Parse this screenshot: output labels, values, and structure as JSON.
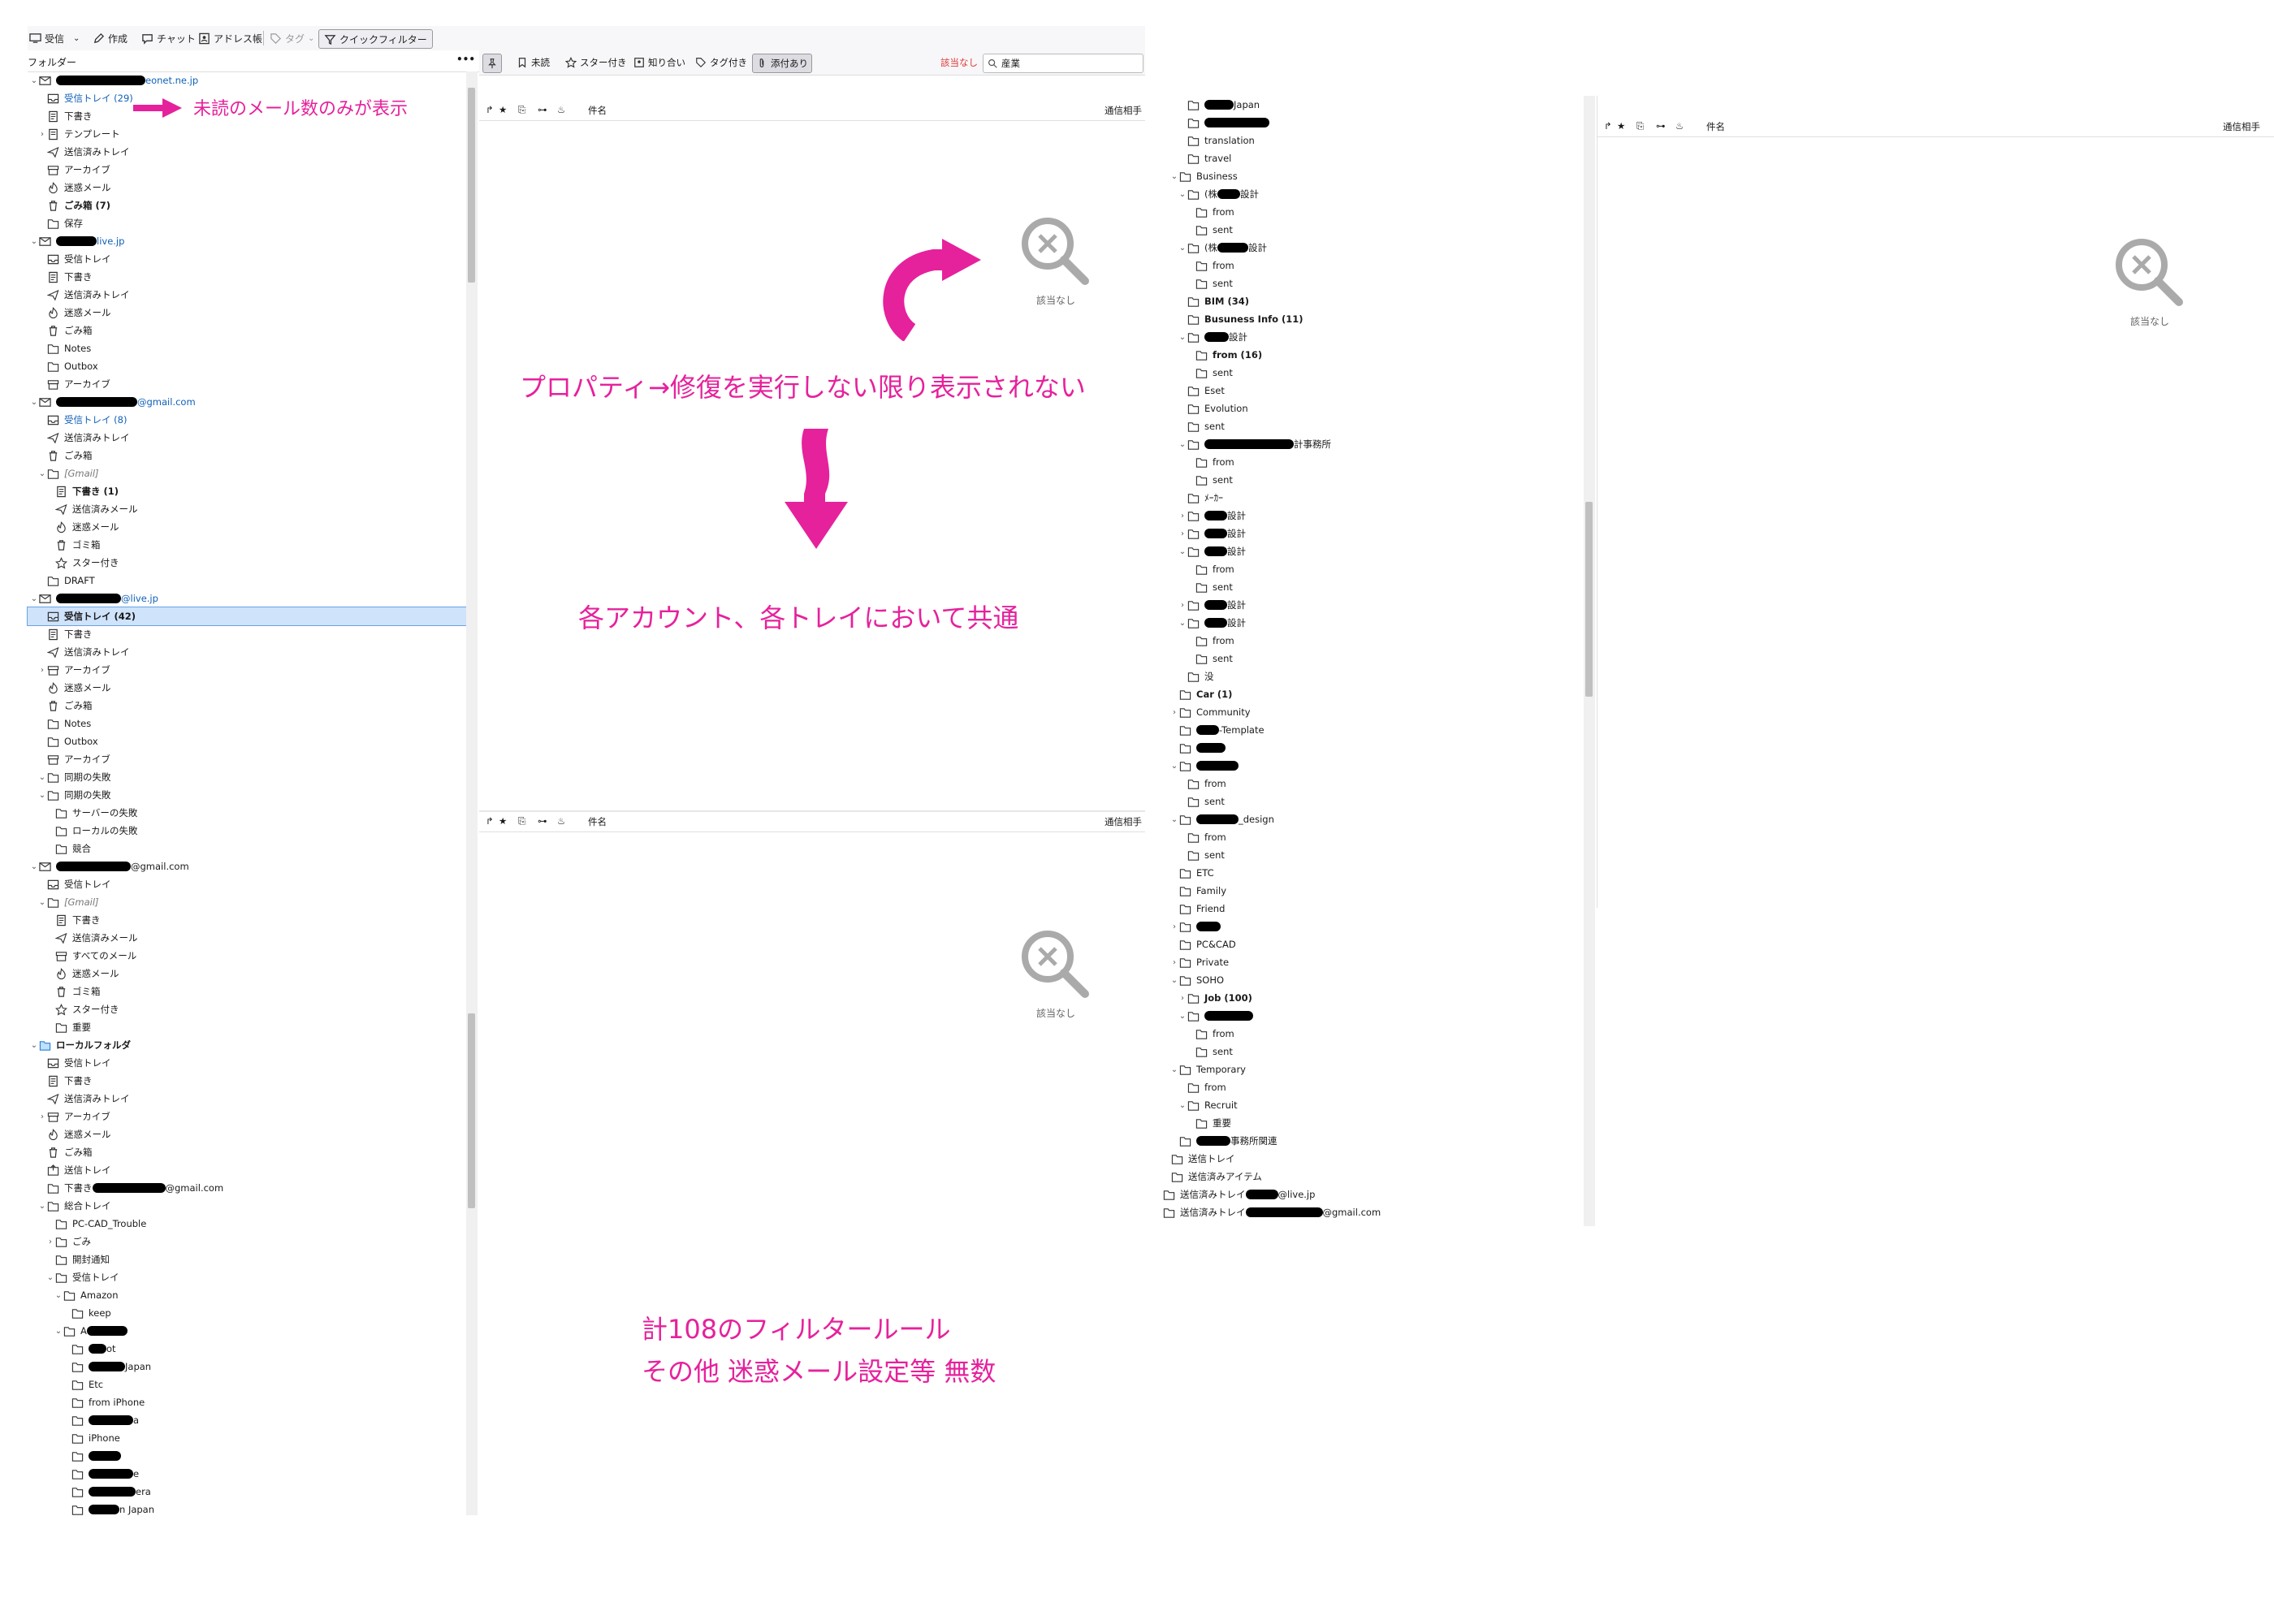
{
  "toolbar": {
    "get_messages": "受信",
    "write": "作成",
    "chat": "チャット",
    "address_book": "アドレス帳",
    "tag": "タグ",
    "quick_filter": "クイックフィルター"
  },
  "folder_pane": {
    "header": "フォルダー",
    "menu_glyph": "•••"
  },
  "left_tree": [
    {
      "twisty": "v",
      "icon": "account",
      "label": "eonet.ne.jp",
      "redact": 110,
      "cls": "acct",
      "indent": 0
    },
    {
      "twisty": "",
      "icon": "inbox",
      "label": "受信トレイ (29)",
      "cls": "blue",
      "indent": 1
    },
    {
      "twisty": "",
      "icon": "draft",
      "label": "下書き",
      "indent": 1
    },
    {
      "twisty": ">",
      "icon": "template",
      "label": "テンプレート",
      "indent": 1
    },
    {
      "twisty": "",
      "icon": "sent",
      "label": "送信済みトレイ",
      "indent": 1
    },
    {
      "twisty": "",
      "icon": "archive",
      "label": "アーカイブ",
      "indent": 1
    },
    {
      "twisty": "",
      "icon": "junk",
      "label": "迷惑メール",
      "indent": 1
    },
    {
      "twisty": "",
      "icon": "trash",
      "label": "ごみ箱 (7)",
      "cls": "bold",
      "indent": 1
    },
    {
      "twisty": "",
      "icon": "folder",
      "label": "保存",
      "indent": 1
    },
    {
      "twisty": "v",
      "icon": "account",
      "label": "live.jp",
      "redact": 50,
      "cls": "acct",
      "indent": 0
    },
    {
      "twisty": "",
      "icon": "inbox",
      "label": "受信トレイ",
      "indent": 1
    },
    {
      "twisty": "",
      "icon": "draft",
      "label": "下書き",
      "indent": 1
    },
    {
      "twisty": "",
      "icon": "sent",
      "label": "送信済みトレイ",
      "indent": 1
    },
    {
      "twisty": "",
      "icon": "junk",
      "label": "迷惑メール",
      "indent": 1
    },
    {
      "twisty": "",
      "icon": "trash",
      "label": "ごみ箱",
      "indent": 1
    },
    {
      "twisty": "",
      "icon": "folder",
      "label": "Notes",
      "indent": 1
    },
    {
      "twisty": "",
      "icon": "folder",
      "label": "Outbox",
      "indent": 1
    },
    {
      "twisty": "",
      "icon": "archive",
      "label": "アーカイブ",
      "indent": 1
    },
    {
      "twisty": "v",
      "icon": "account",
      "label": "@gmail.com",
      "redact": 100,
      "cls": "acct",
      "indent": 0
    },
    {
      "twisty": "",
      "icon": "inbox",
      "label": "受信トレイ (8)",
      "cls": "blue",
      "indent": 1
    },
    {
      "twisty": "",
      "icon": "sent",
      "label": "送信済みトレイ",
      "indent": 1
    },
    {
      "twisty": "",
      "icon": "trash",
      "label": "ごみ箱",
      "indent": 1
    },
    {
      "twisty": "v",
      "icon": "folder",
      "label": "[Gmail]",
      "cls": "ital",
      "indent": 1
    },
    {
      "twisty": "",
      "icon": "draft",
      "label": "下書き (1)",
      "cls": "bold",
      "indent": 2
    },
    {
      "twisty": "",
      "icon": "sent",
      "label": "送信済みメール",
      "indent": 2
    },
    {
      "twisty": "",
      "icon": "junk",
      "label": "迷惑メール",
      "indent": 2
    },
    {
      "twisty": "",
      "icon": "trash",
      "label": "ゴミ箱",
      "indent": 2
    },
    {
      "twisty": "",
      "icon": "star",
      "label": "スター付き",
      "indent": 2
    },
    {
      "twisty": "",
      "icon": "folder",
      "label": "DRAFT",
      "indent": 1
    },
    {
      "twisty": "v",
      "icon": "account",
      "label": "@live.jp",
      "redact": 80,
      "cls": "acct",
      "indent": 0
    },
    {
      "twisty": "",
      "icon": "inbox",
      "label": "受信トレイ (42)",
      "cls": "bold",
      "indent": 1,
      "selected": true
    },
    {
      "twisty": "",
      "icon": "draft",
      "label": "下書き",
      "indent": 1
    },
    {
      "twisty": "",
      "icon": "sent",
      "label": "送信済みトレイ",
      "indent": 1
    },
    {
      "twisty": ">",
      "icon": "archive",
      "label": "アーカイブ",
      "indent": 1
    },
    {
      "twisty": "",
      "icon": "junk",
      "label": "迷惑メール",
      "indent": 1
    },
    {
      "twisty": "",
      "icon": "trash",
      "label": "ごみ箱",
      "indent": 1
    },
    {
      "twisty": "",
      "icon": "folder",
      "label": "Notes",
      "indent": 1
    },
    {
      "twisty": "",
      "icon": "folder",
      "label": "Outbox",
      "indent": 1
    },
    {
      "twisty": "",
      "icon": "archive",
      "label": "アーカイブ",
      "indent": 1
    },
    {
      "twisty": "v",
      "icon": "folder",
      "label": "同期の失敗",
      "indent": 1
    },
    {
      "twisty": "v",
      "icon": "folder",
      "label": "同期の失敗",
      "indent": 1
    },
    {
      "twisty": "",
      "icon": "folder",
      "label": "サーバーの失敗",
      "indent": 2
    },
    {
      "twisty": "",
      "icon": "folder",
      "label": "ローカルの失敗",
      "indent": 2
    },
    {
      "twisty": "",
      "icon": "folder",
      "label": "競合",
      "indent": 2
    },
    {
      "twisty": "v",
      "icon": "account",
      "label": "@gmail.com",
      "redact": 92,
      "indent": 0
    },
    {
      "twisty": "",
      "icon": "inbox",
      "label": "受信トレイ",
      "indent": 1
    },
    {
      "twisty": "v",
      "icon": "folder",
      "label": "[Gmail]",
      "cls": "ital",
      "indent": 1
    },
    {
      "twisty": "",
      "icon": "draft",
      "label": "下書き",
      "indent": 2
    },
    {
      "twisty": "",
      "icon": "sent",
      "label": "送信済みメール",
      "indent": 2
    },
    {
      "twisty": "",
      "icon": "archive",
      "label": "すべてのメール",
      "indent": 2
    },
    {
      "twisty": "",
      "icon": "junk",
      "label": "迷惑メール",
      "indent": 2
    },
    {
      "twisty": "",
      "icon": "trash",
      "label": "ゴミ箱",
      "indent": 2
    },
    {
      "twisty": "",
      "icon": "star",
      "label": "スター付き",
      "indent": 2
    },
    {
      "twisty": "",
      "icon": "folder",
      "label": "重要",
      "indent": 2
    },
    {
      "twisty": "v",
      "icon": "localfolder",
      "label": "ローカルフォルダ",
      "cls": "bold",
      "indent": 0
    },
    {
      "twisty": "",
      "icon": "inbox",
      "label": "受信トレイ",
      "indent": 1
    },
    {
      "twisty": "",
      "icon": "draft",
      "label": "下書き",
      "indent": 1
    },
    {
      "twisty": "",
      "icon": "sent",
      "label": "送信済みトレイ",
      "indent": 1
    },
    {
      "twisty": ">",
      "icon": "archive",
      "label": "アーカイブ",
      "indent": 1
    },
    {
      "twisty": "",
      "icon": "junk",
      "label": "迷惑メール",
      "indent": 1
    },
    {
      "twisty": "",
      "icon": "trash",
      "label": "ごみ箱",
      "indent": 1
    },
    {
      "twisty": "",
      "icon": "outbox",
      "label": "送信トレイ",
      "indent": 1
    },
    {
      "twisty": "",
      "icon": "folder",
      "label": "下書き",
      "redact_mid": 90,
      "label2": "@gmail.com",
      "indent": 1
    },
    {
      "twisty": "v",
      "icon": "folder",
      "label": "総合トレイ",
      "indent": 1
    },
    {
      "twisty": "",
      "icon": "folder",
      "label": "PC-CAD_Trouble",
      "indent": 2
    },
    {
      "twisty": ">",
      "icon": "folder",
      "label": "ごみ",
      "indent": 2
    },
    {
      "twisty": "",
      "icon": "folder",
      "label": "開封通知",
      "indent": 2
    },
    {
      "twisty": "v",
      "icon": "folder",
      "label": "受信トレイ",
      "indent": 2
    },
    {
      "twisty": "v",
      "icon": "folder",
      "label": "Amazon",
      "indent": 3
    },
    {
      "twisty": "",
      "icon": "folder",
      "label": "keep",
      "indent": 4
    },
    {
      "twisty": "v",
      "icon": "folder",
      "label": "A",
      "redact": 50,
      "indent": 3
    },
    {
      "twisty": "",
      "icon": "folder",
      "label": "ot",
      "redact_pre": 22,
      "indent": 4
    },
    {
      "twisty": "",
      "icon": "folder",
      "label": "Japan",
      "redact_pre": 45,
      "indent": 4
    },
    {
      "twisty": "",
      "icon": "folder",
      "label": "Etc",
      "indent": 4
    },
    {
      "twisty": "",
      "icon": "folder",
      "label": "from iPhone",
      "indent": 4
    },
    {
      "twisty": "",
      "icon": "folder",
      "label": "a",
      "redact_pre": 55,
      "indent": 4
    },
    {
      "twisty": "",
      "icon": "folder",
      "label": "iPhone",
      "indent": 4
    },
    {
      "twisty": "",
      "icon": "folder",
      "label": "",
      "redact_pre": 40,
      "indent": 4
    },
    {
      "twisty": "",
      "icon": "folder",
      "label": "e",
      "redact_pre": 55,
      "indent": 4
    },
    {
      "twisty": "",
      "icon": "folder",
      "label": "era",
      "redact_pre": 58,
      "indent": 4
    },
    {
      "twisty": "",
      "icon": "folder",
      "label": "n Japan",
      "redact_pre": 38,
      "indent": 4
    }
  ],
  "filter_bar": {
    "sticky_icon": "pin-icon",
    "unread": "未読",
    "starred": "スター付き",
    "contact": "知り合い",
    "tags": "タグ付き",
    "attachment": "添付あり",
    "no_results": "該当なし",
    "search_placeholder": "産業"
  },
  "thread_columns": {
    "subject": "件名",
    "correspondent": "通信相手"
  },
  "empty_text": "該当なし",
  "annotations": {
    "unread_only": "未読のメール数のみが表示",
    "repair_note": "プロパティ→修復を実行しない限り表示されない",
    "common_note": "各アカウント、各トレイにおいて共通",
    "filter_rules": "計108のフィルタールール",
    "other_settings": "その他 迷惑メール設定等 無数"
  },
  "right_tree": [
    {
      "twisty": "",
      "icon": "folder",
      "label": "Japan",
      "redact_pre": 36,
      "indent": 1
    },
    {
      "twisty": "",
      "icon": "folder",
      "label": "",
      "redact_pre": 80,
      "indent": 1
    },
    {
      "twisty": "",
      "icon": "folder",
      "label": "translation",
      "indent": 1
    },
    {
      "twisty": "",
      "icon": "folder",
      "label": "travel",
      "indent": 1
    },
    {
      "twisty": "v",
      "icon": "folder",
      "label": "Business",
      "indent": 0
    },
    {
      "twisty": "v",
      "icon": "folder",
      "label": "(株",
      "redact_mid": 28,
      "label2": "設計",
      "indent": 1
    },
    {
      "twisty": "",
      "icon": "folder",
      "label": "from",
      "indent": 2
    },
    {
      "twisty": "",
      "icon": "folder",
      "label": "sent",
      "indent": 2
    },
    {
      "twisty": "v",
      "icon": "folder",
      "label": "(株",
      "redact_mid": 38,
      "label2": "設計",
      "indent": 1
    },
    {
      "twisty": "",
      "icon": "folder",
      "label": "from",
      "indent": 2
    },
    {
      "twisty": "",
      "icon": "folder",
      "label": "sent",
      "indent": 2
    },
    {
      "twisty": "",
      "icon": "folder",
      "label": "BIM (34)",
      "cls": "bold",
      "indent": 1
    },
    {
      "twisty": "",
      "icon": "folder",
      "label": "Busuness Info (11)",
      "cls": "bold",
      "indent": 1
    },
    {
      "twisty": "v",
      "icon": "folder",
      "label": "設計",
      "redact_pre": 30,
      "indent": 1
    },
    {
      "twisty": "",
      "icon": "folder",
      "label": "from (16)",
      "cls": "bold",
      "indent": 2
    },
    {
      "twisty": "",
      "icon": "folder",
      "label": "sent",
      "indent": 2
    },
    {
      "twisty": "",
      "icon": "folder",
      "label": "Eset",
      "indent": 1
    },
    {
      "twisty": "",
      "icon": "folder",
      "label": "Evolution",
      "indent": 1
    },
    {
      "twisty": "",
      "icon": "folder",
      "label": "sent",
      "indent": 1
    },
    {
      "twisty": "v",
      "icon": "folder",
      "label": "計事務所",
      "redact_pre": 110,
      "indent": 1
    },
    {
      "twisty": "",
      "icon": "folder",
      "label": "from",
      "indent": 2
    },
    {
      "twisty": "",
      "icon": "folder",
      "label": "sent",
      "indent": 2
    },
    {
      "twisty": "",
      "icon": "folder",
      "label": "ﾒｰｶｰ",
      "indent": 1
    },
    {
      "twisty": ">",
      "icon": "folder",
      "label": "設計",
      "redact_pre": 28,
      "indent": 1
    },
    {
      "twisty": ">",
      "icon": "folder",
      "label": "設計",
      "redact_pre": 28,
      "indent": 1
    },
    {
      "twisty": "v",
      "icon": "folder",
      "label": "設計",
      "redact_pre": 28,
      "indent": 1
    },
    {
      "twisty": "",
      "icon": "folder",
      "label": "from",
      "indent": 2
    },
    {
      "twisty": "",
      "icon": "folder",
      "label": "sent",
      "indent": 2
    },
    {
      "twisty": ">",
      "icon": "folder",
      "label": "設計",
      "redact_pre": 28,
      "indent": 1
    },
    {
      "twisty": "v",
      "icon": "folder",
      "label": "設計",
      "redact_pre": 28,
      "indent": 1
    },
    {
      "twisty": "",
      "icon": "folder",
      "label": "from",
      "indent": 2
    },
    {
      "twisty": "",
      "icon": "folder",
      "label": "sent",
      "indent": 2
    },
    {
      "twisty": "",
      "icon": "folder",
      "label": "没",
      "indent": 1
    },
    {
      "twisty": "",
      "icon": "folder",
      "label": "Car (1)",
      "cls": "bold",
      "indent": 0
    },
    {
      "twisty": ">",
      "icon": "folder",
      "label": "Community",
      "indent": 0
    },
    {
      "twisty": "",
      "icon": "folder",
      "label": "-Template",
      "redact_pre": 28,
      "indent": 0
    },
    {
      "twisty": "",
      "icon": "folder",
      "label": "",
      "redact_pre": 36,
      "indent": 0
    },
    {
      "twisty": "v",
      "icon": "folder",
      "label": "",
      "redact_pre": 52,
      "indent": 0
    },
    {
      "twisty": "",
      "icon": "folder",
      "label": "from",
      "indent": 1
    },
    {
      "twisty": "",
      "icon": "folder",
      "label": "sent",
      "indent": 1
    },
    {
      "twisty": "v",
      "icon": "folder",
      "label": "_design",
      "redact_pre": 52,
      "indent": 0
    },
    {
      "twisty": "",
      "icon": "folder",
      "label": "from",
      "indent": 1
    },
    {
      "twisty": "",
      "icon": "folder",
      "label": "sent",
      "indent": 1
    },
    {
      "twisty": "",
      "icon": "folder",
      "label": "ETC",
      "indent": 0
    },
    {
      "twisty": "",
      "icon": "folder",
      "label": "Family",
      "indent": 0
    },
    {
      "twisty": "",
      "icon": "folder",
      "label": "Friend",
      "indent": 0
    },
    {
      "twisty": ">",
      "icon": "folder",
      "label": "",
      "redact_pre": 30,
      "indent": 0
    },
    {
      "twisty": "",
      "icon": "folder",
      "label": "PC&CAD",
      "indent": 0
    },
    {
      "twisty": ">",
      "icon": "folder",
      "label": "Private",
      "indent": 0
    },
    {
      "twisty": "v",
      "icon": "folder",
      "label": "SOHO",
      "indent": 0
    },
    {
      "twisty": ">",
      "icon": "folder",
      "label": "Job (100)",
      "cls": "bold",
      "indent": 1
    },
    {
      "twisty": "v",
      "icon": "folder",
      "label": "",
      "redact_pre": 60,
      "indent": 1
    },
    {
      "twisty": "",
      "icon": "folder",
      "label": "from",
      "indent": 2
    },
    {
      "twisty": "",
      "icon": "folder",
      "label": "sent",
      "indent": 2
    },
    {
      "twisty": "v",
      "icon": "folder",
      "label": "Temporary",
      "indent": 0
    },
    {
      "twisty": "",
      "icon": "folder",
      "label": "from",
      "indent": 1
    },
    {
      "twisty": "v",
      "icon": "folder",
      "label": "Recruit",
      "indent": 1
    },
    {
      "twisty": "",
      "icon": "folder",
      "label": "重要",
      "indent": 2
    },
    {
      "twisty": "",
      "icon": "folder",
      "label": "事務所関連",
      "redact_pre": 42,
      "indent": 0
    },
    {
      "twisty": "",
      "icon": "folder",
      "label": "送信トレイ",
      "indent": -1
    },
    {
      "twisty": "",
      "icon": "folder",
      "label": "送信済みアイテム",
      "indent": -1
    },
    {
      "twisty": "",
      "icon": "folder",
      "label": "送信済みトレイ",
      "redact_mid": 40,
      "label2": "@live.jp",
      "indent": -2
    },
    {
      "twisty": "",
      "icon": "folder",
      "label": "送信済みトレイ",
      "redact_mid": 95,
      "label2": "@gmail.com",
      "indent": -2
    }
  ],
  "colors": {
    "accent_pink": "#e6219c",
    "selection": "#cfe3fb",
    "account_blue": "#1060b8"
  }
}
